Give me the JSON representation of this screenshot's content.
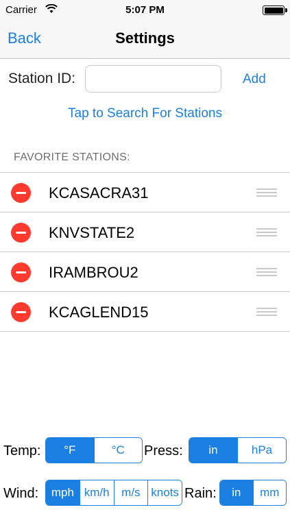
{
  "status_bar": {
    "carrier": "Carrier",
    "time": "5:07 PM"
  },
  "nav": {
    "back_label": "Back",
    "title": "Settings"
  },
  "station_entry": {
    "label": "Station ID:",
    "value": "",
    "placeholder": "",
    "add_label": "Add"
  },
  "search_link": "Tap to Search For Stations",
  "favorites": {
    "header": "FAVORITE STATIONS:",
    "items": [
      {
        "name": "KCASACRA31"
      },
      {
        "name": "KNVSTATE2"
      },
      {
        "name": "IRAMBROU2"
      },
      {
        "name": "KCAGLEND15"
      }
    ]
  },
  "units": {
    "temp": {
      "label": "Temp:",
      "options": [
        "°F",
        "°C"
      ],
      "selected": "°F"
    },
    "press": {
      "label": "Press:",
      "options": [
        "in",
        "hPa"
      ],
      "selected": "in"
    },
    "wind": {
      "label": "Wind:",
      "options": [
        "mph",
        "km/h",
        "m/s",
        "knots"
      ],
      "selected": "mph"
    },
    "rain": {
      "label": "Rain:",
      "options": [
        "in",
        "mm"
      ],
      "selected": "in"
    }
  },
  "colors": {
    "accent": "#1a7fe0",
    "delete": "#ff3b30",
    "separator": "#c8c7cc"
  }
}
